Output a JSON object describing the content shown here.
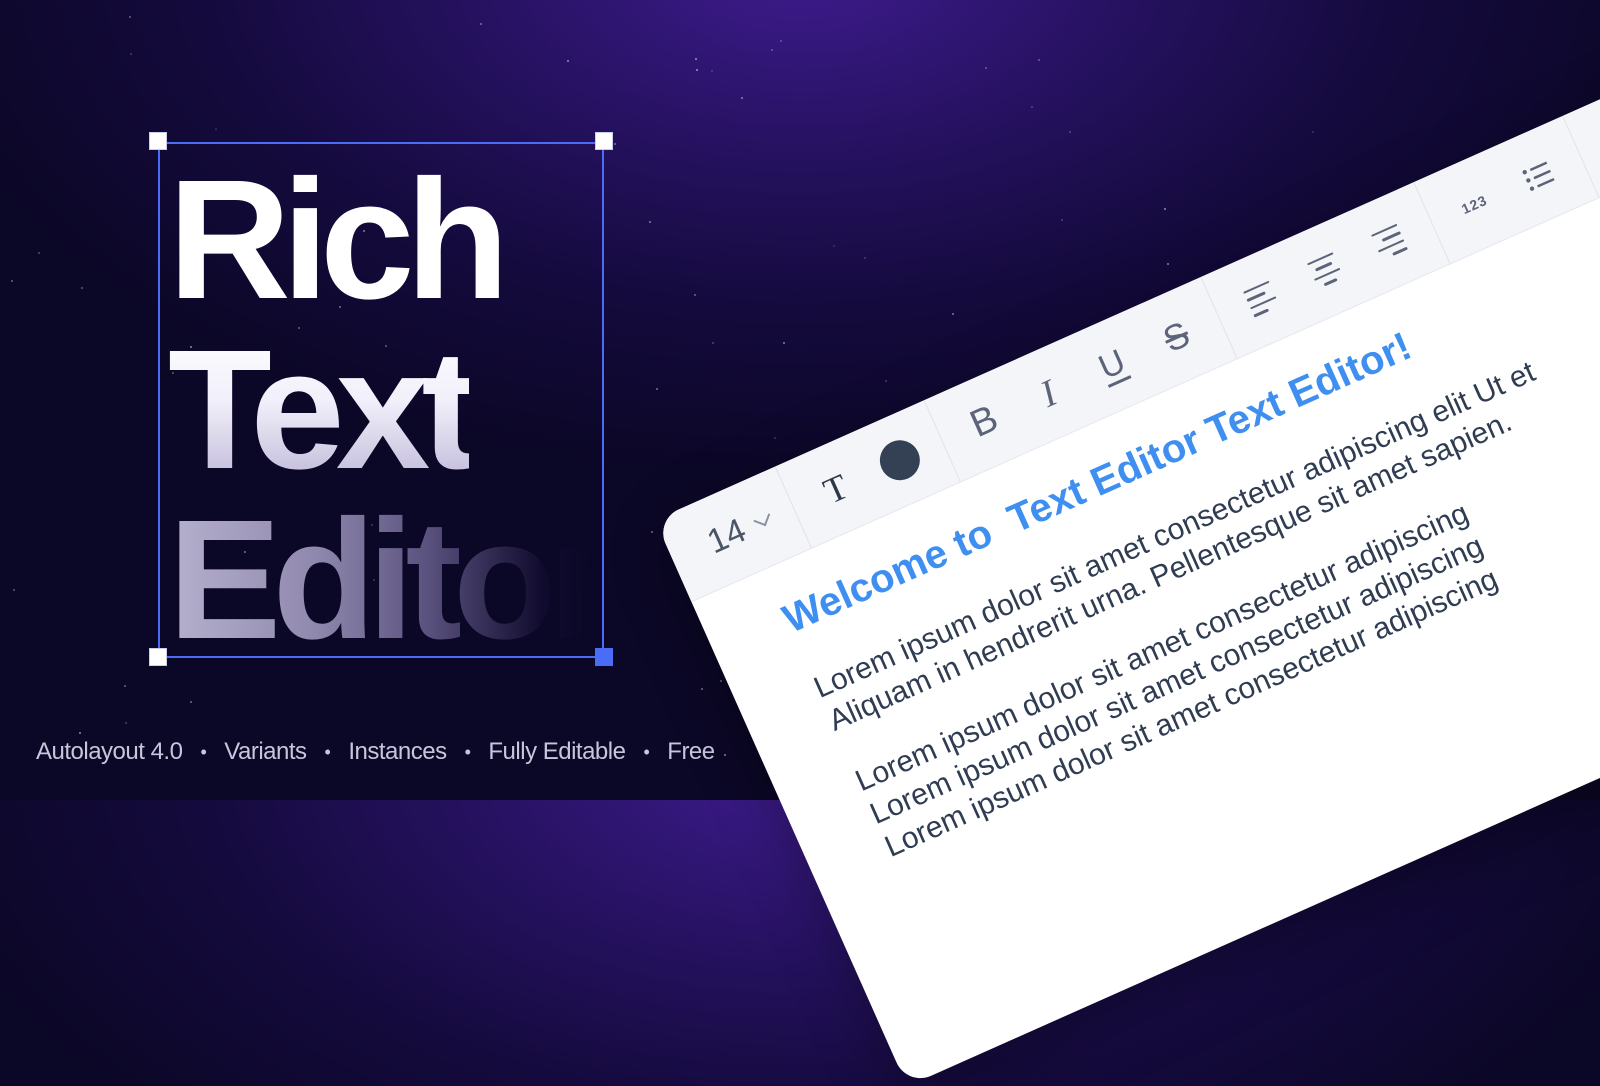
{
  "title": {
    "line1": "Rich",
    "line2": "Text",
    "line3": "Editor"
  },
  "features": [
    "Autolayout 4.0",
    "Variants",
    "Instances",
    "Fully Editable",
    "Free"
  ],
  "features_separator": "•",
  "editor": {
    "toolbar": {
      "font_size": "14",
      "text_color": "#344054"
    },
    "heading": "Welcome to  Text Editor Text Editor!",
    "paragraph1": [
      "Lorem ipsum dolor sit amet consectetur adipiscing elit Ut et",
      "Aliquam in hendrerit urna. Pellentesque sit amet sapien."
    ],
    "paragraph2": [
      "Lorem ipsum dolor sit amet consectetur adipiscing",
      "Lorem ipsum dolor sit amet consectetur adipiscing",
      "Lorem ipsum dolor sit amet consectetur adipiscing"
    ]
  },
  "colors": {
    "accent": "#4a6cf7",
    "heading": "#3f8ff0",
    "body_text": "#2f3c52"
  }
}
